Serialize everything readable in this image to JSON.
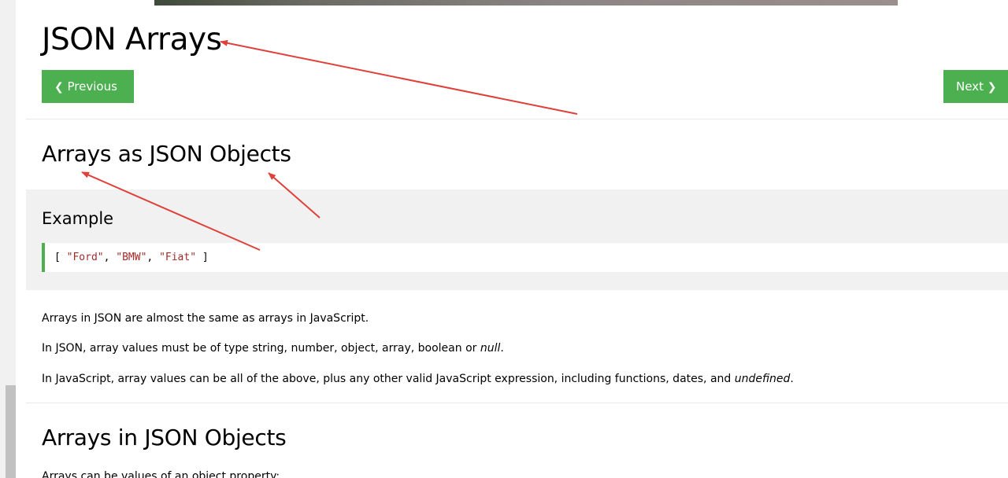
{
  "page": {
    "title": "JSON Arrays",
    "nav": {
      "previous_label": "Previous",
      "next_label": "Next",
      "previous_icon": "chevron-left-icon",
      "next_icon": "chevron-right-icon"
    }
  },
  "section1": {
    "heading": "Arrays as JSON Objects",
    "example": {
      "title": "Example",
      "code_open": "[ ",
      "code_items": [
        "\"Ford\"",
        "\"BMW\"",
        "\"Fiat\""
      ],
      "code_sep": ", ",
      "code_close": " ]"
    },
    "paragraphs": {
      "p1": "Arrays in JSON are almost the same as arrays in JavaScript.",
      "p2_prefix": "In JSON, array values must be of type string, number, object, array, boolean or ",
      "p2_em": "null",
      "p2_suffix": ".",
      "p3_prefix": "In JavaScript, array values can be all of the above, plus any other valid JavaScript expression, including functions, dates, and ",
      "p3_em": "undefined",
      "p3_suffix": "."
    }
  },
  "section2": {
    "heading": "Arrays in JSON Objects",
    "intro": "Arrays can be values of an object property:"
  },
  "colors": {
    "accent_green": "#4caf50",
    "annotation_red": "#e0403a",
    "code_string": "#a52a2a",
    "example_bg": "#f1f1f1"
  }
}
